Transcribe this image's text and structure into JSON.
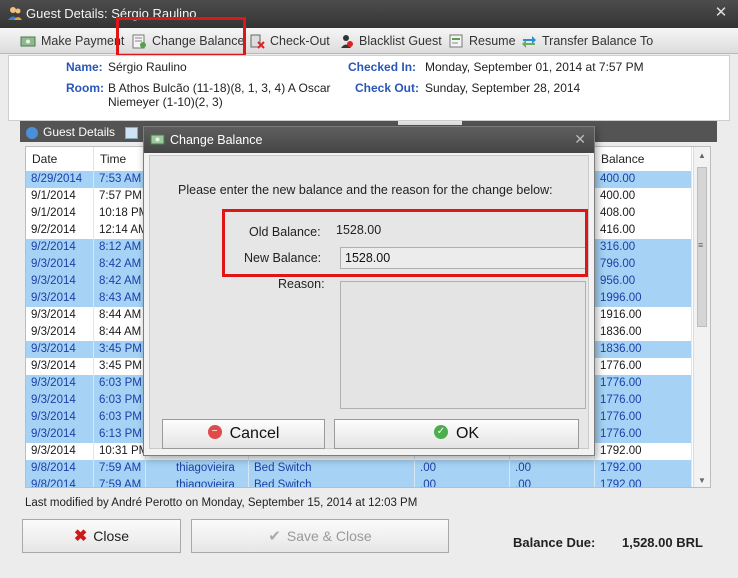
{
  "window": {
    "title": "Guest Details: Sérgio Raulino"
  },
  "toolbar": {
    "items": [
      {
        "label": "Make Payment",
        "icon": "payment-icon"
      },
      {
        "label": "Change Balance",
        "icon": "change-balance-icon"
      },
      {
        "label": "Check-Out",
        "icon": "checkout-icon"
      },
      {
        "label": "Blacklist Guest",
        "icon": "blacklist-icon"
      },
      {
        "label": "Resume",
        "icon": "resume-icon"
      },
      {
        "label": "Transfer Balance To",
        "icon": "transfer-icon"
      }
    ]
  },
  "guest": {
    "name_label": "Name:",
    "name": "Sérgio Raulino",
    "room_label": "Room:",
    "room_line1": "B Athos Bulcão (11-18)(8, 1, 3, 4) A Oscar",
    "room_line2": "Niemeyer (1-10)(2, 3)",
    "checked_in_label": "Checked In:",
    "checked_in": "Monday, September 01, 2014 at 7:57 PM",
    "check_out_label": "Check Out:",
    "check_out": "Sunday, September 28, 2014"
  },
  "tabs": [
    {
      "label": "Guest Details"
    }
  ],
  "grid": {
    "columns": [
      "Date",
      "Time",
      "Balance"
    ],
    "rows": [
      {
        "date": "8/29/2014",
        "time": "7:53 AM",
        "user": "",
        "desc": "",
        "c1": "",
        "c2": "",
        "balance": "400.00",
        "selected": true
      },
      {
        "date": "9/1/2014",
        "time": "7:57 PM",
        "user": "",
        "desc": "",
        "c1": "",
        "c2": "",
        "balance": "400.00",
        "selected": false
      },
      {
        "date": "9/1/2014",
        "time": "10:18 PM",
        "user": "",
        "desc": "",
        "c1": "",
        "c2": "",
        "balance": "408.00",
        "selected": false
      },
      {
        "date": "9/2/2014",
        "time": "12:14 AM",
        "user": "",
        "desc": "",
        "c1": "",
        "c2": "",
        "balance": "416.00",
        "selected": false
      },
      {
        "date": "9/2/2014",
        "time": "8:12 AM",
        "user": "",
        "desc": "",
        "c1": "",
        "c2": "",
        "balance": "316.00",
        "selected": true
      },
      {
        "date": "9/3/2014",
        "time": "8:42 AM",
        "user": "",
        "desc": "",
        "c1": "",
        "c2": "",
        "balance": "796.00",
        "selected": true
      },
      {
        "date": "9/3/2014",
        "time": "8:42 AM",
        "user": "",
        "desc": "",
        "c1": "",
        "c2": "",
        "balance": "956.00",
        "selected": true
      },
      {
        "date": "9/3/2014",
        "time": "8:43 AM",
        "user": "",
        "desc": "",
        "c1": "",
        "c2": "",
        "balance": "1996.00",
        "selected": true
      },
      {
        "date": "9/3/2014",
        "time": "8:44 AM",
        "user": "",
        "desc": "",
        "c1": "",
        "c2": "",
        "balance": "1916.00",
        "selected": false
      },
      {
        "date": "9/3/2014",
        "time": "8:44 AM",
        "user": "",
        "desc": "",
        "c1": "",
        "c2": "",
        "balance": "1836.00",
        "selected": false
      },
      {
        "date": "9/3/2014",
        "time": "3:45 PM",
        "user": "",
        "desc": "",
        "c1": "",
        "c2": "",
        "balance": "1836.00",
        "selected": true
      },
      {
        "date": "9/3/2014",
        "time": "3:45 PM",
        "user": "",
        "desc": "",
        "c1": "",
        "c2": "",
        "balance": "1776.00",
        "selected": false
      },
      {
        "date": "9/3/2014",
        "time": "6:03 PM",
        "user": "",
        "desc": "",
        "c1": "",
        "c2": "",
        "balance": "1776.00",
        "selected": true
      },
      {
        "date": "9/3/2014",
        "time": "6:03 PM",
        "user": "",
        "desc": "",
        "c1": "",
        "c2": "",
        "balance": "1776.00",
        "selected": true
      },
      {
        "date": "9/3/2014",
        "time": "6:03 PM",
        "user": "",
        "desc": "",
        "c1": "",
        "c2": "",
        "balance": "1776.00",
        "selected": true
      },
      {
        "date": "9/3/2014",
        "time": "6:13 PM",
        "user": "",
        "desc": "",
        "c1": "",
        "c2": "",
        "balance": "1776.00",
        "selected": true
      },
      {
        "date": "9/3/2014",
        "time": "10:31 PM",
        "user": "",
        "desc": "",
        "c1": "",
        "c2": "",
        "balance": "1792.00",
        "selected": false
      },
      {
        "date": "9/8/2014",
        "time": "7:59 AM",
        "user": "thiagovieira",
        "desc": "Bed Switch",
        "c1": ".00",
        "c2": ".00",
        "balance": "1792.00",
        "selected": true
      },
      {
        "date": "9/8/2014",
        "time": "7:59 AM",
        "user": "thiagovieira",
        "desc": "Bed Switch",
        "c1": ".00",
        "c2": ".00",
        "balance": "1792.00",
        "selected": true
      }
    ]
  },
  "footer": {
    "modified_text": "Last modified by André Perotto on Monday, September 15, 2014 at 12:03 PM",
    "close_label": "Close",
    "save_close_label": "Save & Close",
    "balance_due_label": "Balance Due:",
    "balance_due_value": "1,528.00 BRL"
  },
  "dialog": {
    "title": "Change Balance",
    "instruction": "Please enter the new balance and the reason for the change below:",
    "old_balance_label": "Old Balance:",
    "old_balance_value": "1528.00",
    "new_balance_label": "New Balance:",
    "new_balance_value": "1528.00",
    "reason_label": "Reason:",
    "reason_value": "",
    "cancel_label": "Cancel",
    "ok_label": "OK"
  },
  "colors": {
    "highlight_red": "#e01515",
    "selected_row": "#a6d3f5",
    "label_blue": "#2a56b8"
  }
}
